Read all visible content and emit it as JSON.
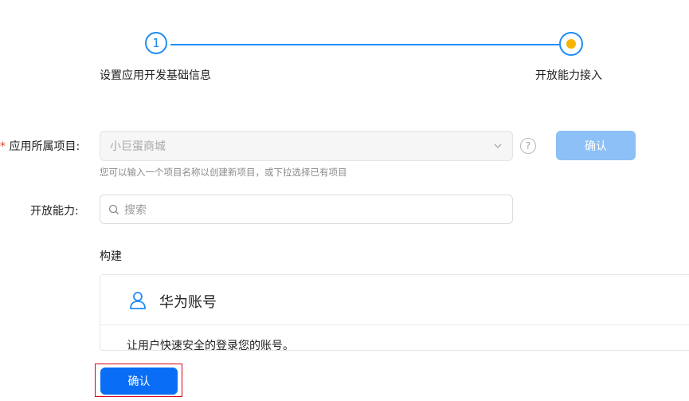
{
  "stepper": {
    "step1_number": "1",
    "step1_label": "设置应用开发基础信息",
    "step2_label": "开放能力接入",
    "accent_color": "#1f8cf2",
    "active_dot_color": "#f5b400"
  },
  "form": {
    "project": {
      "required_mark": "*",
      "label": "应用所属项目:",
      "value": "小巨蛋商城",
      "hint": "您可以输入一个项目名称以创建新项目，或下拉选择已有项目",
      "help_symbol": "?",
      "confirm_label": "确认"
    },
    "capability": {
      "label": "开放能力:",
      "search_placeholder": "搜索"
    }
  },
  "section": {
    "title": "构建",
    "card": {
      "icon": "user-icon",
      "title": "华为账号",
      "description": "让用户快速安全的登录您的账号。"
    }
  },
  "footer": {
    "confirm_label": "确认",
    "primary_color": "#0a6df5",
    "highlight_color": "#d9001b"
  }
}
